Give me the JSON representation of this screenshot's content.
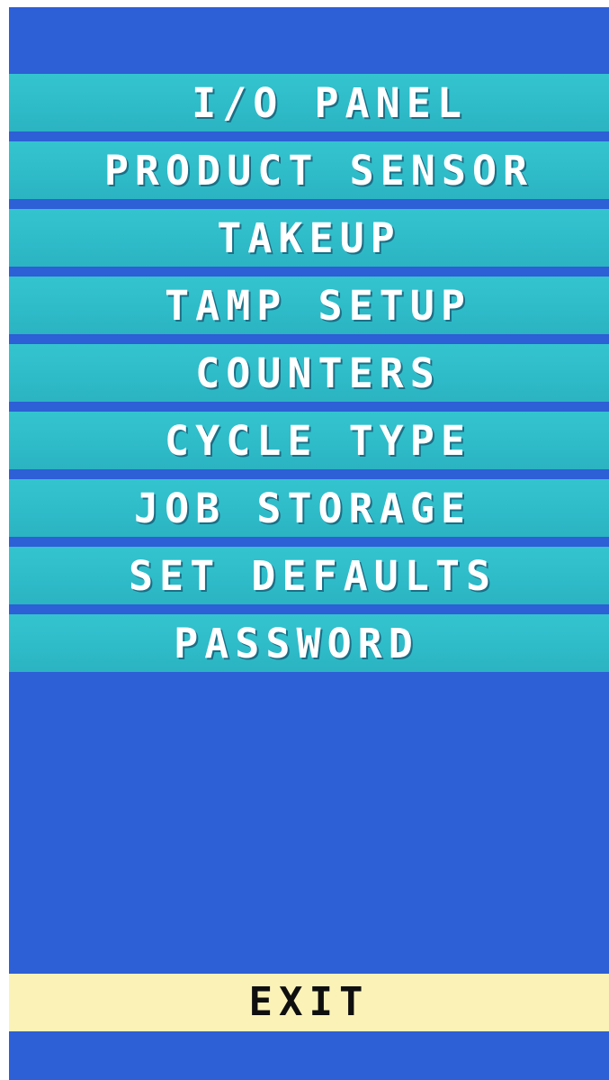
{
  "colors": {
    "background": "#2d5fd6",
    "menu_item": "#2fbcc9",
    "menu_text": "#ffffff",
    "exit_background": "#fbf2b8",
    "exit_text": "#0f0f0f"
  },
  "menu": {
    "items": [
      {
        "label": "I/O PANEL"
      },
      {
        "label": "PRODUCT SENSOR"
      },
      {
        "label": "TAKEUP"
      },
      {
        "label": "TAMP SETUP"
      },
      {
        "label": "COUNTERS"
      },
      {
        "label": "CYCLE TYPE"
      },
      {
        "label": "JOB STORAGE"
      },
      {
        "label": "SET DEFAULTS"
      },
      {
        "label": "PASSWORD"
      }
    ]
  },
  "footer": {
    "exit_label": "EXIT"
  }
}
